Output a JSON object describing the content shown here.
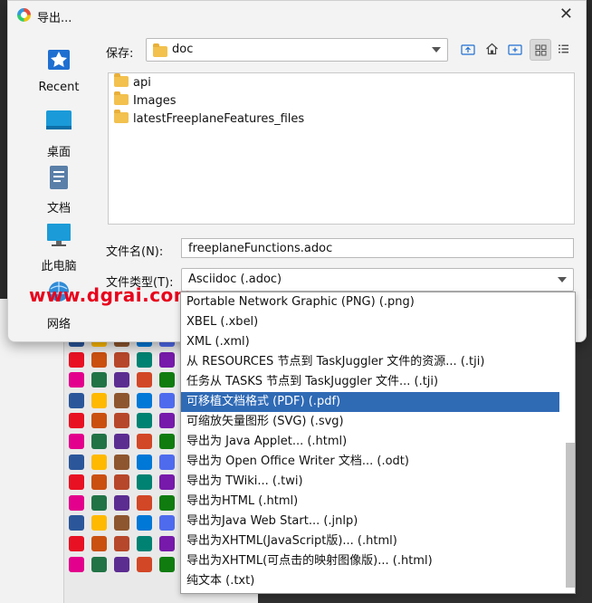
{
  "dialog": {
    "title": "导出...",
    "close_glyph": "✕"
  },
  "places": [
    {
      "label": "Recent",
      "icon": "recent-icon"
    },
    {
      "label": "桌面",
      "icon": "desktop-icon"
    },
    {
      "label": "文档",
      "icon": "documents-icon"
    },
    {
      "label": "此电脑",
      "icon": "computer-icon"
    },
    {
      "label": "网络",
      "icon": "network-icon"
    }
  ],
  "save_in": {
    "label": "保存:",
    "value": "doc"
  },
  "toolbar": [
    "up-folder-icon",
    "home-icon",
    "new-folder-icon",
    "grid-view-icon",
    "list-view-icon"
  ],
  "files": [
    {
      "name": "api"
    },
    {
      "name": "Images"
    },
    {
      "name": "latestFreeplaneFeatures_files"
    }
  ],
  "filename": {
    "label": "文件名(N):",
    "value": "freeplaneFunctions.adoc"
  },
  "filetype": {
    "label": "文件类型(T):",
    "value": "Asciidoc (.adoc)"
  },
  "filetype_options": [
    "Portable Network Graphic (PNG) (.png)",
    "XBEL (.xbel)",
    "XML (.xml)",
    "从 RESOURCES 节点到 TaskJuggler 文件的资源... (.tji)",
    "任务从 TASKS 节点到 TaskJuggler 文件... (.tji)",
    "可移植文档格式 (PDF) (.pdf)",
    "可缩放矢量图形 (SVG) (.svg)",
    "导出为 Java Applet... (.html)",
    "导出为 Open Office Writer 文档... (.odt)",
    "导出为 TWiki... (.twi)",
    "导出为HTML (.html)",
    "导出为Java Web Start... (.jnlp)",
    "导出为XHTML(JavaScript版)... (.html)",
    "导出为XHTML(可点击的映射图像版)... (.html)",
    "纯文本 (.txt)"
  ],
  "selected_option_index": 5,
  "watermark": "www.dgrai.com",
  "colors": {
    "selection": "#2f6ab5",
    "folder": "#f2c14e",
    "watermark": "#e8001c"
  }
}
